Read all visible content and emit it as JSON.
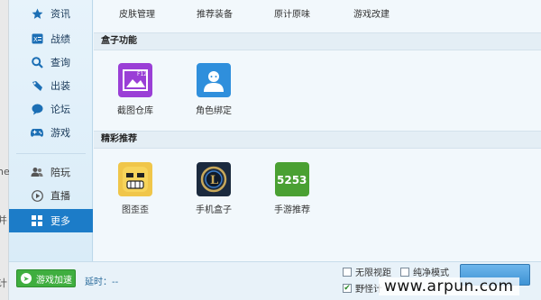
{
  "stray": [
    "he",
    "并",
    "计"
  ],
  "sidebar": {
    "items": [
      {
        "label": "资讯",
        "icon": "star-icon"
      },
      {
        "label": "战绩",
        "icon": "scoreboard-icon"
      },
      {
        "label": "查询",
        "icon": "search-icon"
      },
      {
        "label": "出装",
        "icon": "equipment-icon"
      },
      {
        "label": "论坛",
        "icon": "chat-bubble-icon"
      },
      {
        "label": "游戏",
        "icon": "gamepad-icon"
      }
    ],
    "sub_items": [
      {
        "label": "陪玩",
        "icon": "people-icon"
      },
      {
        "label": "直播",
        "icon": "play-icon"
      },
      {
        "label": "更多",
        "icon": "grid-icon",
        "active": true
      }
    ]
  },
  "top_links": [
    "皮肤管理",
    "推荐装备",
    "原计原味",
    "游戏改建"
  ],
  "sections": {
    "box": {
      "title": "盒子功能",
      "tiles": [
        {
          "label": "截图仓库",
          "icon": "screenshot-gallery-icon",
          "badge": "F12"
        },
        {
          "label": "角色绑定",
          "icon": "user-avatar-icon"
        }
      ]
    },
    "featured": {
      "title": "精彩推荐",
      "tiles": [
        {
          "label": "图歪歪",
          "icon": "funny-face-icon"
        },
        {
          "label": "手机盒子",
          "icon": "lol-logo-icon",
          "badge": "L"
        },
        {
          "label": "手游推荐",
          "icon": "5253-logo-icon",
          "badge": "5253"
        }
      ]
    }
  },
  "bottom": {
    "speed_label": "游戏加速",
    "latency_label": "延时：--",
    "checks": [
      {
        "label": "无限视距",
        "checked": false
      },
      {
        "label": "纯净模式",
        "checked": false
      },
      {
        "label": "野怪计",
        "checked": true
      }
    ]
  },
  "watermark": "www.arpun.com",
  "colors": {
    "accent": "#1c7cc8",
    "green": "#3fae3f"
  }
}
